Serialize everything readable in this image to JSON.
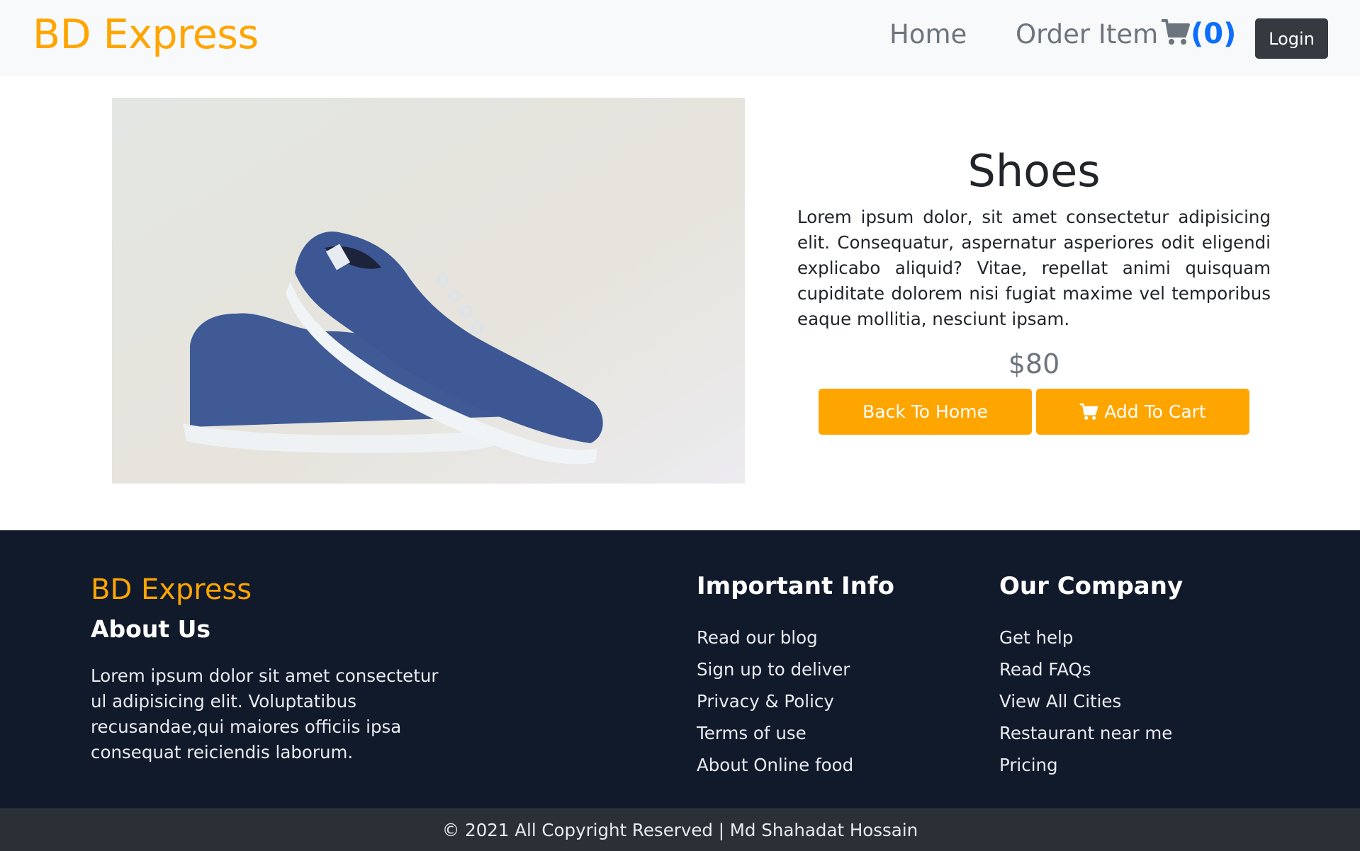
{
  "navbar": {
    "brand": "BD Express",
    "home": "Home",
    "order_item": "Order Item",
    "cart_count": "(0)",
    "login": "Login"
  },
  "product": {
    "title": "Shoes",
    "description": "Lorem ipsum dolor, sit amet consectetur adipisicing elit. Consequatur, aspernatur asperiores odit eligendi explicabo aliquid? Vitae, repellat animi quisquam cupiditate dolorem nisi fugiat maxime vel temporibus eaque mollitia, nesciunt ipsam.",
    "price": "$80",
    "back_button": "Back To Home",
    "cart_button": "Add To Cart"
  },
  "footer": {
    "brand": "BD Express",
    "about_title": "About Us",
    "about_text": "Lorem ipsum dolor sit amet consectetur ul adipisicing elit. Voluptatibus recusandae,qui maiores officiis ipsa consequat reiciendis laborum.",
    "important_title": "Important Info",
    "important_links": [
      "Read our blog",
      "Sign up to deliver",
      "Privacy & Policy",
      "Terms of use",
      "About Online food"
    ],
    "company_title": "Our Company",
    "company_links": [
      "Get help",
      "Read FAQs",
      "View All Cities",
      "Restaurant near me",
      "Pricing"
    ],
    "copyright": "© 2021 All Copyright Reserved | Md Shahadat Hossain"
  },
  "colors": {
    "accent": "#ffa500",
    "footer_bg": "#111a2b",
    "cart_count": "#0d6efd"
  },
  "icons": [
    "shopping-cart-icon"
  ]
}
